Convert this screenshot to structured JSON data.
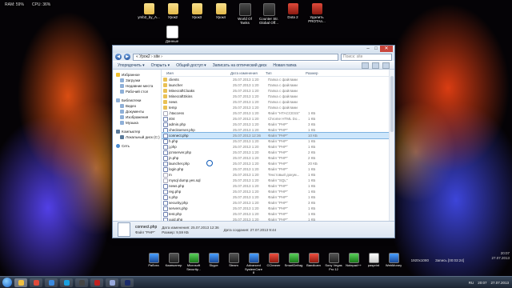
{
  "sysmon": {
    "ram": "RAM: 59%",
    "cpu": "CPU: 36%"
  },
  "desktop": {
    "top_icons": [
      {
        "label": "ymb2_by_A...",
        "kind": "folder"
      },
      {
        "label": "Урок2",
        "kind": "folder"
      },
      {
        "label": "Урок3",
        "kind": "folder"
      },
      {
        "label": "Урок4",
        "kind": "folder"
      },
      {
        "label": "World Of Tanks",
        "kind": "game"
      },
      {
        "label": "Counter Str. Global Off...",
        "kind": "game"
      },
      {
        "label": "Dota 2",
        "kind": "red"
      },
      {
        "label": "Удалить PROTAn...",
        "kind": "red"
      }
    ],
    "single_icon": {
      "label": "Данные",
      "kind": "doc"
    }
  },
  "explorer": {
    "address": "« Урок2 › site ›",
    "search_placeholder": "Поиск: site",
    "toolbar": [
      "Упорядочить ▾",
      "Открыть ▾",
      "Общий доступ ▾",
      "Записать на оптический диск",
      "Новая папка"
    ],
    "nav": [
      {
        "label": "Избранное",
        "kind": "star",
        "sub": false
      },
      {
        "label": "Загрузки",
        "kind": "n",
        "sub": true
      },
      {
        "label": "Недавние места",
        "kind": "n",
        "sub": true
      },
      {
        "label": "Рабочий стол",
        "kind": "n",
        "sub": true
      },
      {
        "gap": true
      },
      {
        "label": "Библиотеки",
        "kind": "n",
        "sub": false
      },
      {
        "label": "Видео",
        "kind": "n",
        "sub": true
      },
      {
        "label": "Документы",
        "kind": "n",
        "sub": true
      },
      {
        "label": "Изображения",
        "kind": "n",
        "sub": true
      },
      {
        "label": "Музыка",
        "kind": "n",
        "sub": true
      },
      {
        "gap": true
      },
      {
        "label": "Компьютер",
        "kind": "pc",
        "sub": false
      },
      {
        "label": "Локальный диск (C:)",
        "kind": "pc",
        "sub": true
      },
      {
        "gap": true
      },
      {
        "label": "Сеть",
        "kind": "net",
        "sub": false
      }
    ],
    "columns": [
      "Имя",
      "Дата изменения",
      "Тип",
      "Размер"
    ],
    "files": [
      {
        "name": "clients",
        "date": "25.07.2013 1:20",
        "type": "Папка с файлами",
        "size": "",
        "kind": "folder"
      },
      {
        "name": "launcher",
        "date": "25.07.2013 1:20",
        "type": "Папка с файлами",
        "size": "",
        "kind": "folder"
      },
      {
        "name": "MinecraftCloaks",
        "date": "25.07.2013 1:20",
        "type": "Папка с файлами",
        "size": "",
        "kind": "folder"
      },
      {
        "name": "MinecraftSkins",
        "date": "25.07.2013 1:20",
        "type": "Папка с файлами",
        "size": "",
        "kind": "folder"
      },
      {
        "name": "news",
        "date": "25.07.2013 1:20",
        "type": "Папка с файлами",
        "size": "",
        "kind": "folder"
      },
      {
        "name": "temp",
        "date": "25.07.2013 1:20",
        "type": "Папка с файлами",
        "size": "",
        "kind": "folder"
      },
      {
        "name": ".htaccess",
        "date": "25.07.2013 1:20",
        "type": "Файл \"HTACCESS\"",
        "size": "1 КБ",
        "kind": "file"
      },
      {
        "name": "404",
        "date": "25.07.2013 1:20",
        "type": "Chrome HTML Do...",
        "size": "1 КБ",
        "kind": "php"
      },
      {
        "name": "admin.php",
        "date": "25.07.2013 1:20",
        "type": "Файл \"PHP\"",
        "size": "3 КБ",
        "kind": "php"
      },
      {
        "name": "checkserver.php",
        "date": "25.07.2013 1:20",
        "type": "Файл \"PHP\"",
        "size": "1 КБ",
        "kind": "php"
      },
      {
        "name": "connect.php",
        "date": "25.07.2013 12:36",
        "type": "Файл \"PHP\"",
        "size": "10 КБ",
        "kind": "php",
        "selected": true
      },
      {
        "name": "h.php",
        "date": "25.07.2013 1:20",
        "type": "Файл \"PHP\"",
        "size": "1 КБ",
        "kind": "php"
      },
      {
        "name": "j.php",
        "date": "25.07.2013 1:20",
        "type": "Файл \"PHP\"",
        "size": "1 КБ",
        "kind": "php"
      },
      {
        "name": "jcmserver.php",
        "date": "25.07.2013 1:20",
        "type": "Файл \"PHP\"",
        "size": "2 КБ",
        "kind": "php"
      },
      {
        "name": "jn.php",
        "date": "25.07.2013 1:20",
        "type": "Файл \"PHP\"",
        "size": "2 КБ",
        "kind": "php"
      },
      {
        "name": "launcher.php",
        "date": "25.07.2013 1:20",
        "type": "Файл \"PHP\"",
        "size": "20 КБ",
        "kind": "php"
      },
      {
        "name": "login.php",
        "date": "25.07.2013 1:20",
        "type": "Файл \"PHP\"",
        "size": "1 КБ",
        "kind": "php"
      },
      {
        "name": "m",
        "date": "25.07.2013 1:20",
        "type": "Текстовый докум...",
        "size": "1 КБ",
        "kind": "file"
      },
      {
        "name": "mysql dump.yes.sql",
        "date": "25.07.2013 1:20",
        "type": "Файл \"SQL\"",
        "size": "1 КБ",
        "kind": "file"
      },
      {
        "name": "news.php",
        "date": "25.07.2013 1:20",
        "type": "Файл \"PHP\"",
        "size": "1 КБ",
        "kind": "php"
      },
      {
        "name": "reg.php",
        "date": "25.07.2013 1:20",
        "type": "Файл \"PHP\"",
        "size": "1 КБ",
        "kind": "php"
      },
      {
        "name": "s.php",
        "date": "25.07.2013 1:20",
        "type": "Файл \"PHP\"",
        "size": "1 КБ",
        "kind": "php"
      },
      {
        "name": "security.php",
        "date": "25.07.2013 1:20",
        "type": "Файл \"PHP\"",
        "size": "3 КБ",
        "kind": "php"
      },
      {
        "name": "servers.php",
        "date": "25.07.2013 1:20",
        "type": "Файл \"PHP\"",
        "size": "1 КБ",
        "kind": "php"
      },
      {
        "name": "test.php",
        "date": "25.07.2013 1:20",
        "type": "Файл \"PHP\"",
        "size": "1 КБ",
        "kind": "php"
      },
      {
        "name": "uuid.php",
        "date": "25.07.2013 1:20",
        "type": "Файл \"PHP\"",
        "size": "1 КБ",
        "kind": "php"
      }
    ],
    "details": {
      "name": "connect.php",
      "modified": "Дата изменения: 25.07.2013 12:36",
      "type": "Файл \"PHP\"",
      "size": "Размер: 9,59 КБ",
      "created": "Дата создания: 27.07.2013 9:44"
    }
  },
  "dock": [
    {
      "label": "Работа",
      "color": "blue"
    },
    {
      "label": "Компьютер",
      "color": ""
    },
    {
      "label": "Microsoft Security...",
      "color": "green"
    },
    {
      "label": "Skype",
      "color": "blue"
    },
    {
      "label": "Steam",
      "color": ""
    },
    {
      "label": "Advanced SystemCare 8",
      "color": "blue"
    },
    {
      "label": "CCleaner",
      "color": "red"
    },
    {
      "label": "SmartDefrag",
      "color": "green"
    },
    {
      "label": "Bandicam",
      "color": "red"
    },
    {
      "label": "Sony Vegas Pro 12",
      "color": ""
    },
    {
      "label": "Notepad++",
      "color": "green"
    },
    {
      "label": "pasprint",
      "color": "white"
    },
    {
      "label": "WebMoney",
      "color": "blue"
    }
  ],
  "sysmon2": {
    "res": "1920x1080",
    "rec": "Запись [00:03:24]"
  },
  "clock_corner": {
    "time": "20:07",
    "date": "27.07.2013"
  },
  "taskbar": {
    "apps": [
      {
        "name": "explorer",
        "color": "#f0c040",
        "active": true
      },
      {
        "name": "chrome",
        "color": "#e04a3a"
      },
      {
        "name": "ie",
        "color": "#3a8ae0"
      },
      {
        "name": "skype",
        "color": "#1aa0e0"
      },
      {
        "name": "steam",
        "color": "#444"
      },
      {
        "name": "filezilla",
        "color": "#c02020"
      },
      {
        "name": "notepad",
        "color": "#9ad"
      },
      {
        "name": "photoshop",
        "color": "#1a2a6a"
      }
    ],
    "lang": "RU",
    "time": "20:07",
    "date": "27.07.2013"
  }
}
